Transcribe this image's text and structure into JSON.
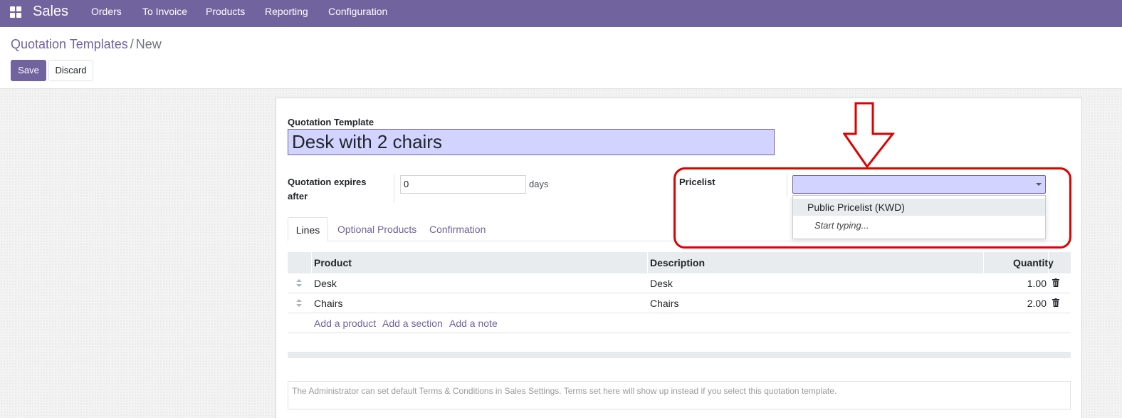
{
  "navbar": {
    "app_name": "Sales",
    "menu": [
      "Orders",
      "To Invoice",
      "Products",
      "Reporting",
      "Configuration"
    ]
  },
  "breadcrumb": {
    "parent": "Quotation Templates",
    "separator": "/",
    "current": "New"
  },
  "buttons": {
    "save": "Save",
    "discard": "Discard"
  },
  "form": {
    "template_label": "Quotation Template",
    "template_name": "Desk with 2 chairs",
    "expires_label": "Quotation expires after",
    "expires_value": "0",
    "expires_unit": "days",
    "pricelist_label": "Pricelist",
    "pricelist_value": ""
  },
  "pricelist_dropdown": {
    "options": [
      "Public Pricelist (KWD)"
    ],
    "hint": "Start typing..."
  },
  "tabs": [
    "Lines",
    "Optional Products",
    "Confirmation"
  ],
  "lines_table": {
    "columns": [
      "Product",
      "Description",
      "Quantity"
    ],
    "rows": [
      {
        "product": "Desk",
        "description": "Desk",
        "quantity": "1.00"
      },
      {
        "product": "Chairs",
        "description": "Chairs",
        "quantity": "2.00"
      }
    ],
    "actions": [
      "Add a product",
      "Add a section",
      "Add a note"
    ]
  },
  "terms_placeholder": "The Administrator can set default Terms & Conditions in Sales Settings. Terms set here will show up instead if you select this quotation template.",
  "colors": {
    "brand": "#71639e",
    "annotation": "#e00000",
    "input_highlight": "#d3d3ff"
  },
  "icons": [
    "apps-grid-icon",
    "caret-down-icon",
    "drag-handle-icon",
    "trash-icon",
    "down-arrow-annotation-icon"
  ]
}
